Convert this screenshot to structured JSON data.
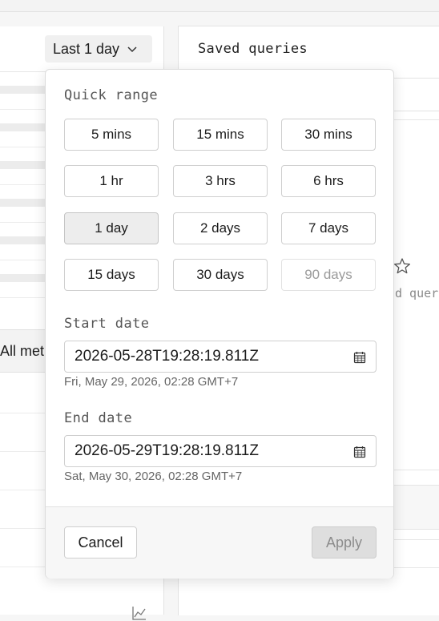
{
  "toolbar": {
    "range_button_label": "Last 1 day"
  },
  "left_panel": {
    "tab_label": "All met"
  },
  "saved_queries": {
    "title": "Saved queries",
    "empty_text": "d quer"
  },
  "time_picker": {
    "quick_range_label": "Quick range",
    "quick_ranges": [
      {
        "label": "5 mins",
        "state": "default"
      },
      {
        "label": "15 mins",
        "state": "default"
      },
      {
        "label": "30 mins",
        "state": "default"
      },
      {
        "label": "1 hr",
        "state": "default"
      },
      {
        "label": "3 hrs",
        "state": "default"
      },
      {
        "label": "6 hrs",
        "state": "default"
      },
      {
        "label": "1 day",
        "state": "selected"
      },
      {
        "label": "2 days",
        "state": "default"
      },
      {
        "label": "7 days",
        "state": "default"
      },
      {
        "label": "15 days",
        "state": "default"
      },
      {
        "label": "30 days",
        "state": "default"
      },
      {
        "label": "90 days",
        "state": "disabled"
      }
    ],
    "start_date": {
      "label": "Start date",
      "value": "2026-05-28T19:28:19.811Z",
      "hint": "Fri, May 29, 2026, 02:28  GMT+7"
    },
    "end_date": {
      "label": "End date",
      "value": "2026-05-29T19:28:19.811Z",
      "hint": "Sat, May 30, 2026, 02:28  GMT+7"
    },
    "cancel_label": "Cancel",
    "apply_label": "Apply"
  },
  "icons": {
    "range_chevron": "chevron-down-icon",
    "date_picker": "calendar-icon",
    "saved_star": "star-icon",
    "chart": "line-chart-icon"
  },
  "colors": {
    "selected_bg": "#ededed",
    "apply_disabled_bg": "#dedede",
    "footer_bg": "#f7f7f7"
  }
}
